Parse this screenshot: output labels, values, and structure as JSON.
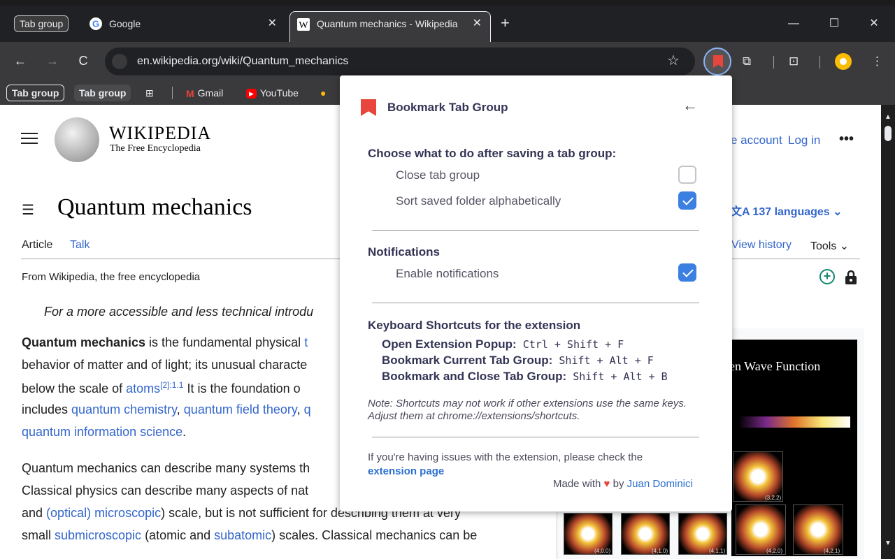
{
  "browser": {
    "tab_group_chip": "Tab group",
    "tabs": [
      {
        "title": "Google",
        "close": "✕"
      },
      {
        "title": "Quantum mechanics - Wikipedia",
        "close": "✕"
      }
    ],
    "new_tab": "+",
    "window_controls": {
      "minimize": "—",
      "maximize": "☐",
      "close": "✕"
    },
    "url": "en.wikipedia.org/wiki/Quantum_mechanics",
    "bookmarks": {
      "group1": "Tab group",
      "group2": "Tab group",
      "items": [
        "Gmail",
        "YouTube"
      ]
    }
  },
  "wiki": {
    "name": "WIKIPEDIA",
    "tagline": "The Free Encyclopedia",
    "create_account": "e account",
    "login": "Log in",
    "more": "•••",
    "title": "Quantum mechanics",
    "languages": "137 languages ⌄",
    "tab_article": "Article",
    "tab_talk": "Talk",
    "view_history": "View history",
    "tools": "Tools ⌄",
    "from": "From Wikipedia, the free encyclopedia",
    "hatnote": "For a more accessible and less technical introdu",
    "p1": {
      "l1_bold": "Quantum mechanics",
      "l1_rest": " is the fundamental physical ",
      "l1_link": "t",
      "l2": "behavior of matter and of light; its unusual characte",
      "l3_pre": "below the scale of ",
      "l3_link": "atoms",
      "l3_sup": "[2]:1.1",
      "l3_rest": " It is the foundation o",
      "l4_pre": "includes ",
      "l4_link1": "quantum chemistry",
      "l4_mid": ", ",
      "l4_link2": "quantum field theory",
      "l4_rest": ", ",
      "l4_link3": "q",
      "l5_link": "quantum information science",
      "l5_rest": "."
    },
    "p2": {
      "l1": "Quantum mechanics can describe many systems th",
      "l2": "Classical physics can describe many aspects of nat",
      "l3_pre": "and ",
      "l3_link": "(optical) microscopic",
      "l3_rest": ") scale, but is not sufficient for describing them at very",
      "l4_pre": "small ",
      "l4_link1": "submicroscopic",
      "l4_mid": " (atomic and ",
      "l4_link2": "subatomic",
      "l4_rest": ") scales. Classical mechanics can be"
    },
    "infobox_title": "gen Wave Function",
    "orb_labels": [
      "(3,2,2)",
      "(4,0,0)",
      "(4,1,0)",
      "(4,1,1)",
      "(4,2,0)",
      "(4,2,1)"
    ]
  },
  "popup": {
    "title": "Bookmark Tab Group",
    "back": "←",
    "section_after_save": "Choose what to do after saving a tab group:",
    "opt_close_group": "Close tab group",
    "opt_close_group_checked": false,
    "opt_sort": "Sort saved folder alphabetically",
    "opt_sort_checked": true,
    "section_notifications": "Notifications",
    "opt_notifications": "Enable notifications",
    "opt_notifications_checked": true,
    "section_shortcuts": "Keyboard Shortcuts for the extension",
    "shortcuts": [
      {
        "label": "Open Extension Popup:",
        "keys": " Ctrl + Shift + F"
      },
      {
        "label": "Bookmark Current Tab Group:",
        "keys": " Shift + Alt + F"
      },
      {
        "label": "Bookmark and Close Tab Group:",
        "keys": " Shift + Alt + B"
      }
    ],
    "note": "Note: Shortcuts may not work if other extensions use the same keys. Adjust them at chrome://extensions/shortcuts.",
    "issue_text": "If you're having issues with the extension, please check the",
    "issue_link": "extension page",
    "made_with": "Made with",
    "heart": "♥",
    "by": "by",
    "author": "Juan Dominici"
  }
}
